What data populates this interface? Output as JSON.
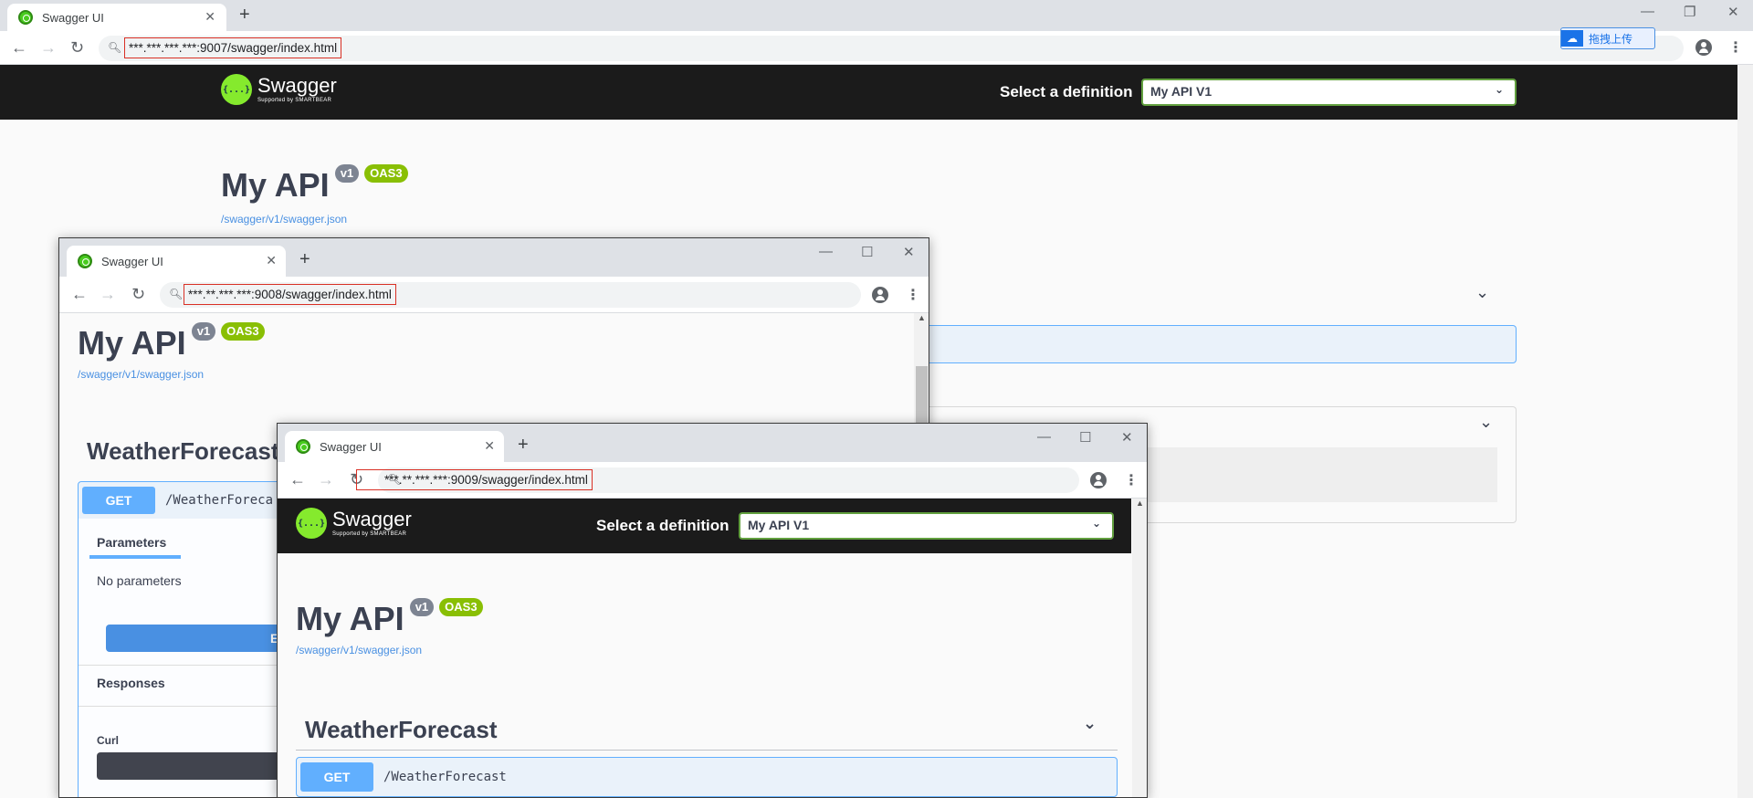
{
  "browser": {
    "tab_title": "Swagger UI",
    "new_tab": "+",
    "extension_label": "拖拽上传"
  },
  "win1": {
    "url": "***.***.***.***:9007/swagger/index.html",
    "select_label": "Select a definition",
    "select_value": "My API V1",
    "api_title": "My API",
    "version_badge": "v1",
    "oas_badge": "OAS3",
    "json_link": "/swagger/v1/swagger.json"
  },
  "win2": {
    "url": "***.**.***.***:9008/swagger/index.html",
    "api_title": "My API",
    "version_badge": "v1",
    "oas_badge": "OAS3",
    "json_link": "/swagger/v1/swagger.json",
    "tag_title": "WeatherForecast",
    "method": "GET",
    "path": "/WeatherForeca",
    "parameters_tab": "Parameters",
    "no_parameters": "No parameters",
    "execute_label": "E",
    "responses_label": "Responses",
    "curl_label": "Curl"
  },
  "win3": {
    "url": "***.**.***.***:9009/swagger/index.html",
    "select_label": "Select a definition",
    "select_value": "My API V1",
    "api_title": "My API",
    "version_badge": "v1",
    "oas_badge": "OAS3",
    "json_link": "/swagger/v1/swagger.json",
    "tag_title": "WeatherForecast",
    "method": "GET",
    "path": "/WeatherForecast"
  },
  "swagger_logo": {
    "name": "Swagger",
    "sub": "Supported by SMARTBEAR",
    "mark": "{...}"
  },
  "colors": {
    "swagger_green": "#85ea2d",
    "get_blue": "#61affe",
    "topbar": "#1b1b1b",
    "url_highlight": "#d93025"
  }
}
